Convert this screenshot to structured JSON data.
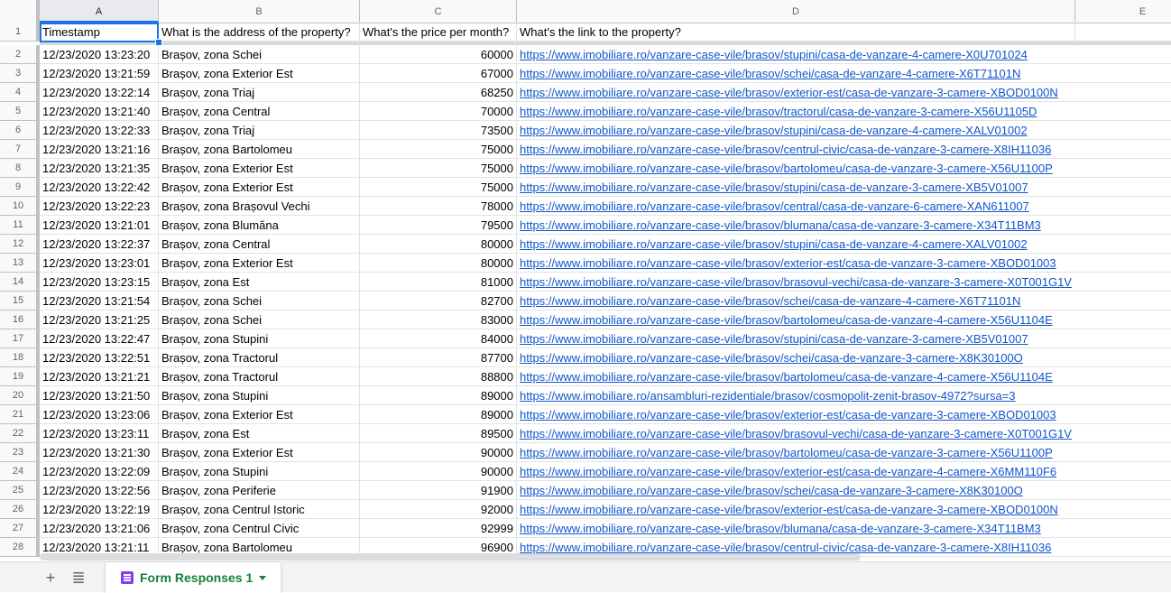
{
  "columns": [
    {
      "id": "A",
      "width": 132
    },
    {
      "id": "B",
      "width": 223
    },
    {
      "id": "C",
      "width": 174
    },
    {
      "id": "D",
      "width": 619
    },
    {
      "id": "E",
      "width": 150
    }
  ],
  "header_row": {
    "num": "1",
    "cells": [
      "Timestamp",
      "What is the address of the property?",
      "What's the price per month?",
      "What's the link to the property?"
    ]
  },
  "rows": [
    {
      "num": "2",
      "ts": "12/23/2020 13:23:20",
      "addr": "Brașov, zona Schei",
      "price": "60000",
      "link": "https://www.imobiliare.ro/vanzare-case-vile/brasov/stupini/casa-de-vanzare-4-camere-X0U701024"
    },
    {
      "num": "3",
      "ts": "12/23/2020 13:21:59",
      "addr": "Brașov, zona Exterior Est",
      "price": "67000",
      "link": "https://www.imobiliare.ro/vanzare-case-vile/brasov/schei/casa-de-vanzare-4-camere-X6T71101N"
    },
    {
      "num": "4",
      "ts": "12/23/2020 13:22:14",
      "addr": "Brașov, zona Triaj",
      "price": "68250",
      "link": "https://www.imobiliare.ro/vanzare-case-vile/brasov/exterior-est/casa-de-vanzare-3-camere-XBOD0100N"
    },
    {
      "num": "5",
      "ts": "12/23/2020 13:21:40",
      "addr": "Brașov, zona Central",
      "price": "70000",
      "link": "https://www.imobiliare.ro/vanzare-case-vile/brasov/tractorul/casa-de-vanzare-3-camere-X56U1105D"
    },
    {
      "num": "6",
      "ts": "12/23/2020 13:22:33",
      "addr": "Brașov, zona Triaj",
      "price": "73500",
      "link": "https://www.imobiliare.ro/vanzare-case-vile/brasov/stupini/casa-de-vanzare-4-camere-XALV01002"
    },
    {
      "num": "7",
      "ts": "12/23/2020 13:21:16",
      "addr": "Brașov, zona Bartolomeu",
      "price": "75000",
      "link": "https://www.imobiliare.ro/vanzare-case-vile/brasov/centrul-civic/casa-de-vanzare-3-camere-X8IH11036"
    },
    {
      "num": "8",
      "ts": "12/23/2020 13:21:35",
      "addr": "Brașov, zona Exterior Est",
      "price": "75000",
      "link": "https://www.imobiliare.ro/vanzare-case-vile/brasov/bartolomeu/casa-de-vanzare-3-camere-X56U1100P"
    },
    {
      "num": "9",
      "ts": "12/23/2020 13:22:42",
      "addr": "Brașov, zona Exterior Est",
      "price": "75000",
      "link": "https://www.imobiliare.ro/vanzare-case-vile/brasov/stupini/casa-de-vanzare-3-camere-XB5V01007"
    },
    {
      "num": "10",
      "ts": "12/23/2020 13:22:23",
      "addr": "Brașov, zona Brașovul Vechi",
      "price": "78000",
      "link": "https://www.imobiliare.ro/vanzare-case-vile/brasov/central/casa-de-vanzare-6-camere-XAN611007"
    },
    {
      "num": "11",
      "ts": "12/23/2020 13:21:01",
      "addr": "Brașov, zona Blumăna",
      "price": "79500",
      "link": "https://www.imobiliare.ro/vanzare-case-vile/brasov/blumana/casa-de-vanzare-3-camere-X34T11BM3"
    },
    {
      "num": "12",
      "ts": "12/23/2020 13:22:37",
      "addr": "Brașov, zona Central",
      "price": "80000",
      "link": "https://www.imobiliare.ro/vanzare-case-vile/brasov/stupini/casa-de-vanzare-4-camere-XALV01002"
    },
    {
      "num": "13",
      "ts": "12/23/2020 13:23:01",
      "addr": "Brașov, zona Exterior Est",
      "price": "80000",
      "link": "https://www.imobiliare.ro/vanzare-case-vile/brasov/exterior-est/casa-de-vanzare-3-camere-XBOD01003"
    },
    {
      "num": "14",
      "ts": "12/23/2020 13:23:15",
      "addr": "Brașov, zona Est",
      "price": "81000",
      "link": "https://www.imobiliare.ro/vanzare-case-vile/brasov/brasovul-vechi/casa-de-vanzare-3-camere-X0T001G1V"
    },
    {
      "num": "15",
      "ts": "12/23/2020 13:21:54",
      "addr": "Brașov, zona Schei",
      "price": "82700",
      "link": "https://www.imobiliare.ro/vanzare-case-vile/brasov/schei/casa-de-vanzare-4-camere-X6T71101N"
    },
    {
      "num": "16",
      "ts": "12/23/2020 13:21:25",
      "addr": "Brașov, zona Schei",
      "price": "83000",
      "link": "https://www.imobiliare.ro/vanzare-case-vile/brasov/bartolomeu/casa-de-vanzare-4-camere-X56U1104E"
    },
    {
      "num": "17",
      "ts": "12/23/2020 13:22:47",
      "addr": "Brașov, zona Stupini",
      "price": "84000",
      "link": "https://www.imobiliare.ro/vanzare-case-vile/brasov/stupini/casa-de-vanzare-3-camere-XB5V01007"
    },
    {
      "num": "18",
      "ts": "12/23/2020 13:22:51",
      "addr": "Brașov, zona Tractorul",
      "price": "87700",
      "link": "https://www.imobiliare.ro/vanzare-case-vile/brasov/schei/casa-de-vanzare-3-camere-X8K30100O"
    },
    {
      "num": "19",
      "ts": "12/23/2020 13:21:21",
      "addr": "Brașov, zona Tractorul",
      "price": "88800",
      "link": "https://www.imobiliare.ro/vanzare-case-vile/brasov/bartolomeu/casa-de-vanzare-4-camere-X56U1104E"
    },
    {
      "num": "20",
      "ts": "12/23/2020 13:21:50",
      "addr": "Brașov, zona Stupini",
      "price": "89000",
      "link": "https://www.imobiliare.ro/ansambluri-rezidentiale/brasov/cosmopolit-zenit-brasov-4972?sursa=3"
    },
    {
      "num": "21",
      "ts": "12/23/2020 13:23:06",
      "addr": "Brașov, zona Exterior Est",
      "price": "89000",
      "link": "https://www.imobiliare.ro/vanzare-case-vile/brasov/exterior-est/casa-de-vanzare-3-camere-XBOD01003"
    },
    {
      "num": "22",
      "ts": "12/23/2020 13:23:11",
      "addr": "Brașov, zona Est",
      "price": "89500",
      "link": "https://www.imobiliare.ro/vanzare-case-vile/brasov/brasovul-vechi/casa-de-vanzare-3-camere-X0T001G1V"
    },
    {
      "num": "23",
      "ts": "12/23/2020 13:21:30",
      "addr": "Brașov, zona Exterior Est",
      "price": "90000",
      "link": "https://www.imobiliare.ro/vanzare-case-vile/brasov/bartolomeu/casa-de-vanzare-3-camere-X56U1100P"
    },
    {
      "num": "24",
      "ts": "12/23/2020 13:22:09",
      "addr": "Brașov, zona Stupini",
      "price": "90000",
      "link": "https://www.imobiliare.ro/vanzare-case-vile/brasov/exterior-est/casa-de-vanzare-4-camere-X6MM110F6"
    },
    {
      "num": "25",
      "ts": "12/23/2020 13:22:56",
      "addr": "Brașov, zona Periferie",
      "price": "91900",
      "link": "https://www.imobiliare.ro/vanzare-case-vile/brasov/schei/casa-de-vanzare-3-camere-X8K30100O"
    },
    {
      "num": "26",
      "ts": "12/23/2020 13:22:19",
      "addr": "Brașov, zona Centrul Istoric",
      "price": "92000",
      "link": "https://www.imobiliare.ro/vanzare-case-vile/brasov/exterior-est/casa-de-vanzare-3-camere-XBOD0100N"
    },
    {
      "num": "27",
      "ts": "12/23/2020 13:21:06",
      "addr": "Brașov, zona Centrul Civic",
      "price": "92999",
      "link": "https://www.imobiliare.ro/vanzare-case-vile/brasov/blumana/casa-de-vanzare-3-camere-X34T11BM3"
    },
    {
      "num": "28",
      "ts": "12/23/2020 13:21:11",
      "addr": "Brașov, zona Bartolomeu",
      "price": "96900",
      "link": "https://www.imobiliare.ro/vanzare-case-vile/brasov/centrul-civic/casa-de-vanzare-3-camere-X8IH11036"
    }
  ],
  "footer": {
    "add_sheet_icon": "plus-icon",
    "all_sheets_icon": "menu-list-icon",
    "active_tab": "Form Responses 1",
    "tab_icon": "forms-icon",
    "tab_menu_icon": "caret-down-icon"
  },
  "colors": {
    "link": "#1155cc",
    "selection": "#1a73e8",
    "tab_text": "#188038",
    "forms_icon": "#7e3ff2"
  }
}
